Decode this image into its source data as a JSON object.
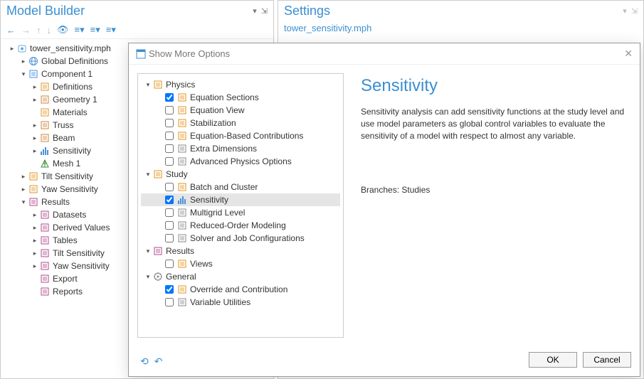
{
  "left": {
    "title": "Model Builder",
    "tree": [
      {
        "ind": 0,
        "tw": "▸",
        "icon": "root",
        "label": "tower_sensitivity.mph"
      },
      {
        "ind": 1,
        "tw": "▸",
        "icon": "globe",
        "label": "Global Definitions"
      },
      {
        "ind": 1,
        "tw": "▾",
        "icon": "component",
        "label": "Component 1"
      },
      {
        "ind": 2,
        "tw": "▸",
        "icon": "defs",
        "label": "Definitions"
      },
      {
        "ind": 2,
        "tw": "▸",
        "icon": "geom",
        "label": "Geometry 1"
      },
      {
        "ind": 2,
        "tw": "",
        "icon": "materials",
        "label": "Materials"
      },
      {
        "ind": 2,
        "tw": "▸",
        "icon": "truss",
        "label": "Truss"
      },
      {
        "ind": 2,
        "tw": "▸",
        "icon": "beam",
        "label": "Beam"
      },
      {
        "ind": 2,
        "tw": "▸",
        "icon": "sens",
        "label": "Sensitivity"
      },
      {
        "ind": 2,
        "tw": "",
        "icon": "mesh",
        "label": "Mesh 1"
      },
      {
        "ind": 1,
        "tw": "▸",
        "icon": "study",
        "label": "Tilt Sensitivity"
      },
      {
        "ind": 1,
        "tw": "▸",
        "icon": "study",
        "label": "Yaw Sensitivity"
      },
      {
        "ind": 1,
        "tw": "▾",
        "icon": "results",
        "label": "Results"
      },
      {
        "ind": 2,
        "tw": "▸",
        "icon": "datasets",
        "label": "Datasets"
      },
      {
        "ind": 2,
        "tw": "▸",
        "icon": "derived",
        "label": "Derived Values"
      },
      {
        "ind": 2,
        "tw": "▸",
        "icon": "tables",
        "label": "Tables"
      },
      {
        "ind": 2,
        "tw": "▸",
        "icon": "plot",
        "label": "Tilt Sensitivity"
      },
      {
        "ind": 2,
        "tw": "▸",
        "icon": "plot",
        "label": "Yaw Sensitivity"
      },
      {
        "ind": 2,
        "tw": "",
        "icon": "export",
        "label": "Export"
      },
      {
        "ind": 2,
        "tw": "",
        "icon": "reports",
        "label": "Reports"
      }
    ]
  },
  "right": {
    "title": "Settings",
    "subtitle": "tower_sensitivity.mph"
  },
  "dialog": {
    "title": "Show More Options",
    "detail_title": "Sensitivity",
    "detail_text": "Sensitivity analysis can add sensitivity functions at the study level and use model parameters as global control variables to evaluate the sensitivity of a model with respect to almost any variable.",
    "branches": "Branches: Studies",
    "ok": "OK",
    "cancel": "Cancel",
    "tree": [
      {
        "ind": 0,
        "tw": "▾",
        "kind": "group",
        "icon": "physics",
        "label": "Physics"
      },
      {
        "ind": 1,
        "tw": "",
        "kind": "item",
        "chk": true,
        "icon": "eqsec",
        "label": "Equation Sections"
      },
      {
        "ind": 1,
        "tw": "",
        "kind": "item",
        "chk": false,
        "icon": "eqview",
        "label": "Equation View"
      },
      {
        "ind": 1,
        "tw": "",
        "kind": "item",
        "chk": false,
        "icon": "stab",
        "label": "Stabilization"
      },
      {
        "ind": 1,
        "tw": "",
        "kind": "item",
        "chk": false,
        "icon": "eqcontrib",
        "label": "Equation-Based Contributions"
      },
      {
        "ind": 1,
        "tw": "",
        "kind": "item",
        "chk": false,
        "icon": "extradim",
        "label": "Extra Dimensions"
      },
      {
        "ind": 1,
        "tw": "",
        "kind": "item",
        "chk": false,
        "icon": "advphys",
        "label": "Advanced Physics Options"
      },
      {
        "ind": 0,
        "tw": "▾",
        "kind": "group",
        "icon": "study",
        "label": "Study"
      },
      {
        "ind": 1,
        "tw": "",
        "kind": "item",
        "chk": false,
        "icon": "batch",
        "label": "Batch and Cluster"
      },
      {
        "ind": 1,
        "tw": "",
        "kind": "item",
        "chk": true,
        "sel": true,
        "icon": "sens",
        "label": "Sensitivity"
      },
      {
        "ind": 1,
        "tw": "",
        "kind": "item",
        "chk": false,
        "icon": "multigrid",
        "label": "Multigrid Level"
      },
      {
        "ind": 1,
        "tw": "",
        "kind": "item",
        "chk": false,
        "icon": "rom",
        "label": "Reduced-Order Modeling"
      },
      {
        "ind": 1,
        "tw": "",
        "kind": "item",
        "chk": false,
        "icon": "solver",
        "label": "Solver and Job Configurations"
      },
      {
        "ind": 0,
        "tw": "▾",
        "kind": "group",
        "icon": "results",
        "label": "Results"
      },
      {
        "ind": 1,
        "tw": "",
        "kind": "item",
        "chk": false,
        "icon": "views",
        "label": "Views"
      },
      {
        "ind": 0,
        "tw": "▾",
        "kind": "group",
        "icon": "general",
        "label": "General"
      },
      {
        "ind": 1,
        "tw": "",
        "kind": "item",
        "chk": true,
        "icon": "override",
        "label": "Override and Contribution"
      },
      {
        "ind": 1,
        "tw": "",
        "kind": "item",
        "chk": false,
        "icon": "varutil",
        "label": "Variable Utilities"
      }
    ]
  },
  "icons": {
    "root": "#6aa8d8",
    "globe": "#4a90d9",
    "component": "#4a90d9",
    "defs": "#e0941f",
    "geom": "#d0843a",
    "materials": "#e0941f",
    "truss": "#d0843a",
    "beam": "#d0843a",
    "sens": "#4a90d9",
    "mesh": "#3a8e3a",
    "study": "#e0941f",
    "results": "#b14a8e",
    "datasets": "#b14a8e",
    "derived": "#b14a8e",
    "tables": "#b14a8e",
    "plot": "#b14a8e",
    "export": "#b14a8e",
    "reports": "#b14a8e",
    "physics": "#e0941f",
    "eqsec": "#e0941f",
    "eqview": "#e0941f",
    "stab": "#e0941f",
    "eqcontrib": "#e0941f",
    "extradim": "#888",
    "advphys": "#888",
    "batch": "#e0941f",
    "multigrid": "#888",
    "rom": "#888",
    "solver": "#888",
    "views": "#e0941f",
    "general": "#888",
    "override": "#e0941f",
    "varutil": "#888"
  }
}
